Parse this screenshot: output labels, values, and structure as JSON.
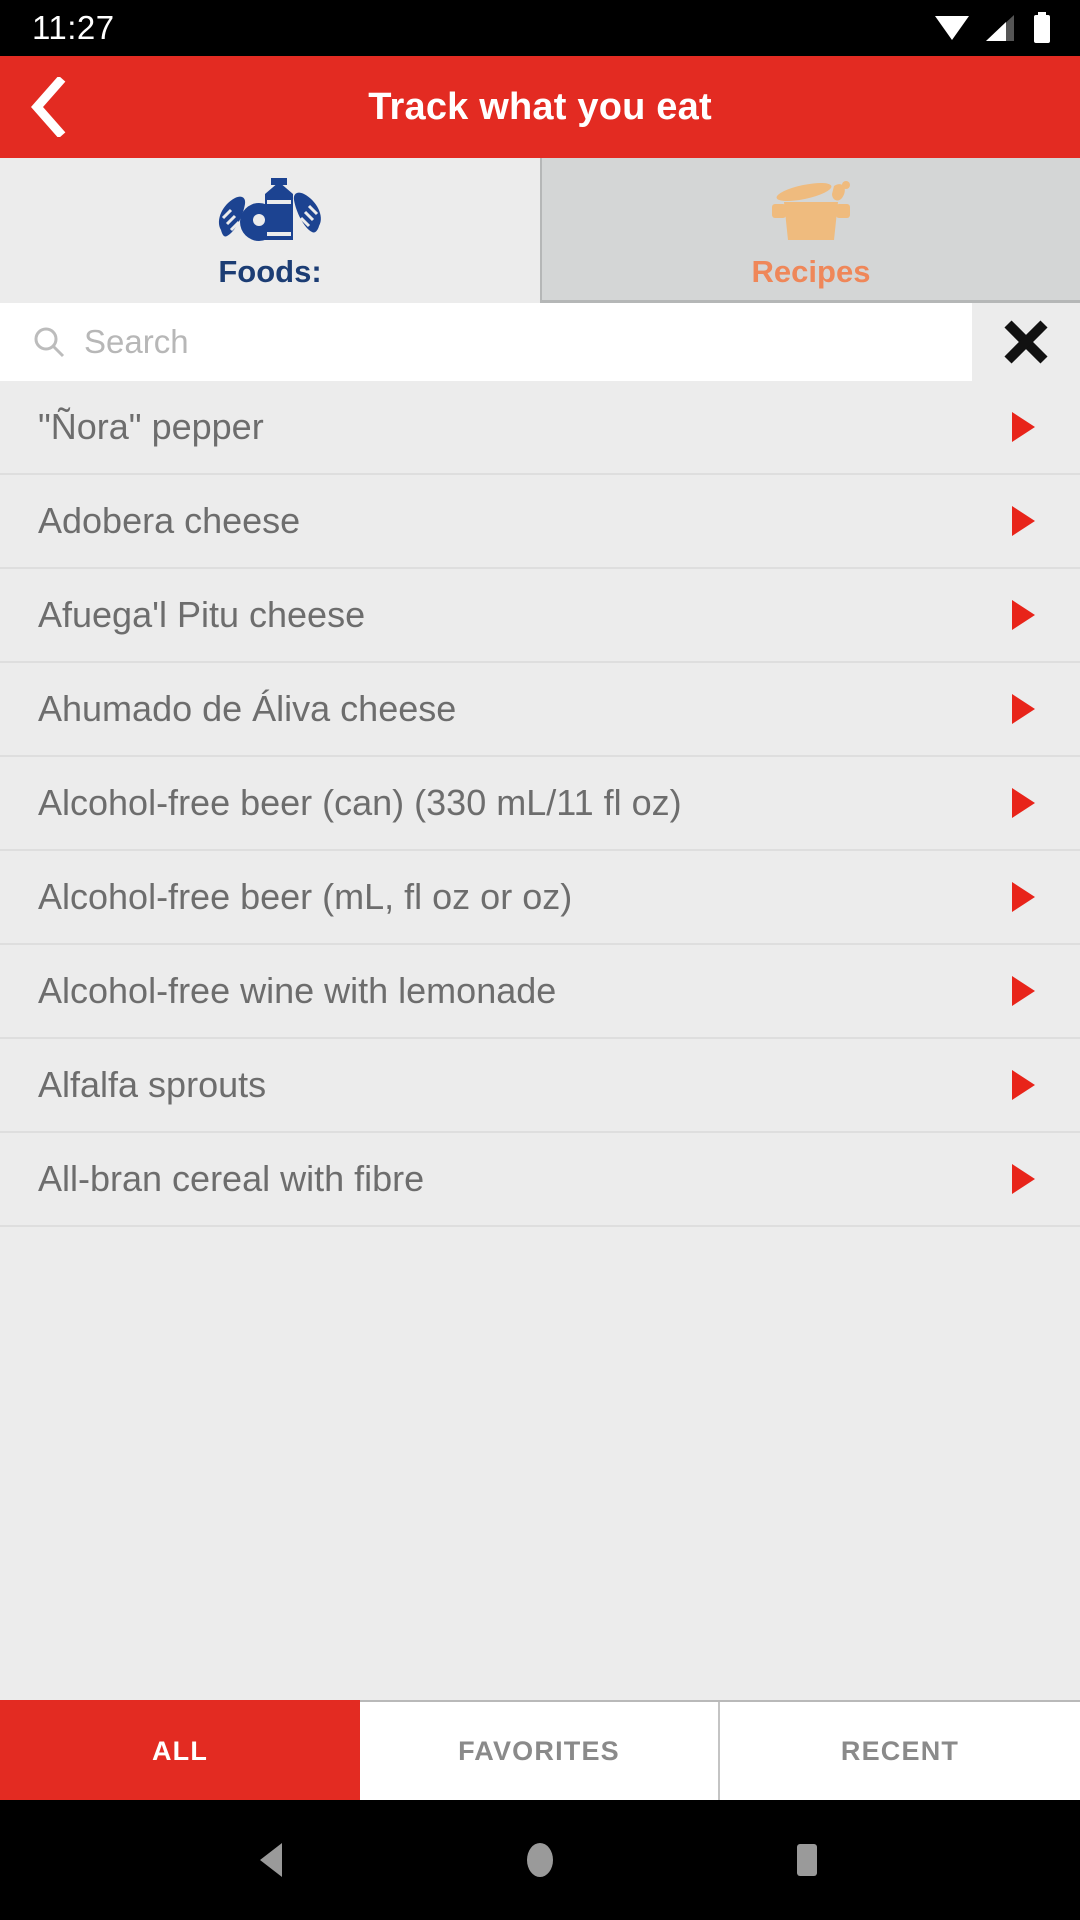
{
  "status_bar": {
    "time": "11:27",
    "icons": [
      "wifi-icon",
      "signal-icon",
      "battery-icon"
    ]
  },
  "app_bar": {
    "back_icon": "back-chevron-icon",
    "title": "Track what you eat",
    "background": "#e32b22"
  },
  "top_tabs": [
    {
      "label": "Foods:",
      "icon": "milk-and-bread-icon",
      "active": true,
      "color": "#1c3d74"
    },
    {
      "label": "Recipes",
      "icon": "cooking-pot-icon",
      "active": false,
      "color": "#ef8759"
    }
  ],
  "search": {
    "placeholder": "Search",
    "value": "",
    "search_icon": "search-icon",
    "clear_icon": "close-x-icon"
  },
  "list": {
    "arrow_icon": "play-triangle-icon",
    "arrow_color": "#e8241a",
    "items": [
      "\"Ñora\" pepper",
      "Adobera cheese",
      "Afuega'l Pitu cheese",
      "Ahumado de Áliva cheese",
      "Alcohol-free beer (can) (330 mL/11 fl oz)",
      "Alcohol-free beer (mL, fl oz or oz)",
      "Alcohol-free wine with lemonade",
      "Alfalfa sprouts",
      "All-bran cereal with fibre"
    ]
  },
  "bottom_tabs": [
    {
      "label": "ALL",
      "active": true
    },
    {
      "label": "FAVORITES",
      "active": false
    },
    {
      "label": "RECENT",
      "active": false
    }
  ],
  "nav_bar": {
    "back": "nav-back-triangle-icon",
    "home": "nav-home-circle-icon",
    "recents": "nav-recents-square-icon"
  }
}
